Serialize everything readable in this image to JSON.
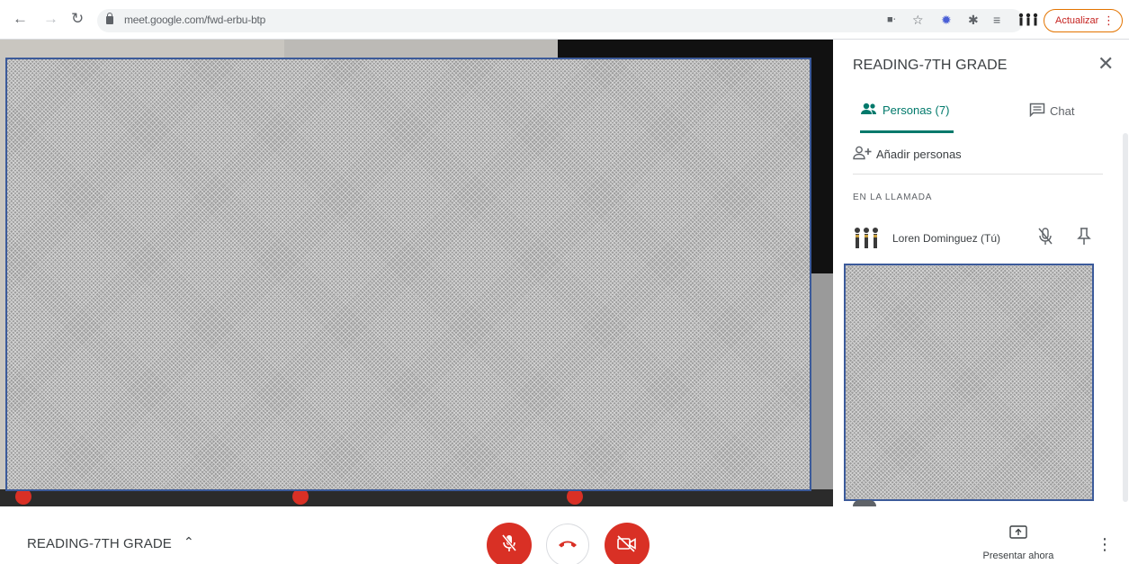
{
  "browser": {
    "url": "meet.google.com/fwd-erbu-btp",
    "update_label": "Actualizar",
    "icons": [
      "back-icon",
      "forward-icon",
      "reload-icon",
      "lock-icon",
      "cast-icon",
      "star-icon",
      "extension-icon",
      "puzzle-icon",
      "media-icon",
      "profile-icon",
      "menu-dots-icon"
    ]
  },
  "panel": {
    "title": "READING-7TH GRADE",
    "tabs": {
      "people": "Personas (7)",
      "chat": "Chat"
    },
    "add_people": "Añadir personas",
    "section_label": "EN LA LLAMADA",
    "participants": [
      {
        "name": "Loren Dominguez (Tú)"
      }
    ]
  },
  "bottom_bar": {
    "meeting_title": "READING-7TH GRADE",
    "present_label": "Presentar ahora"
  },
  "colors": {
    "accent": "#00796b",
    "danger": "#d93025",
    "update_border": "#e37400"
  }
}
